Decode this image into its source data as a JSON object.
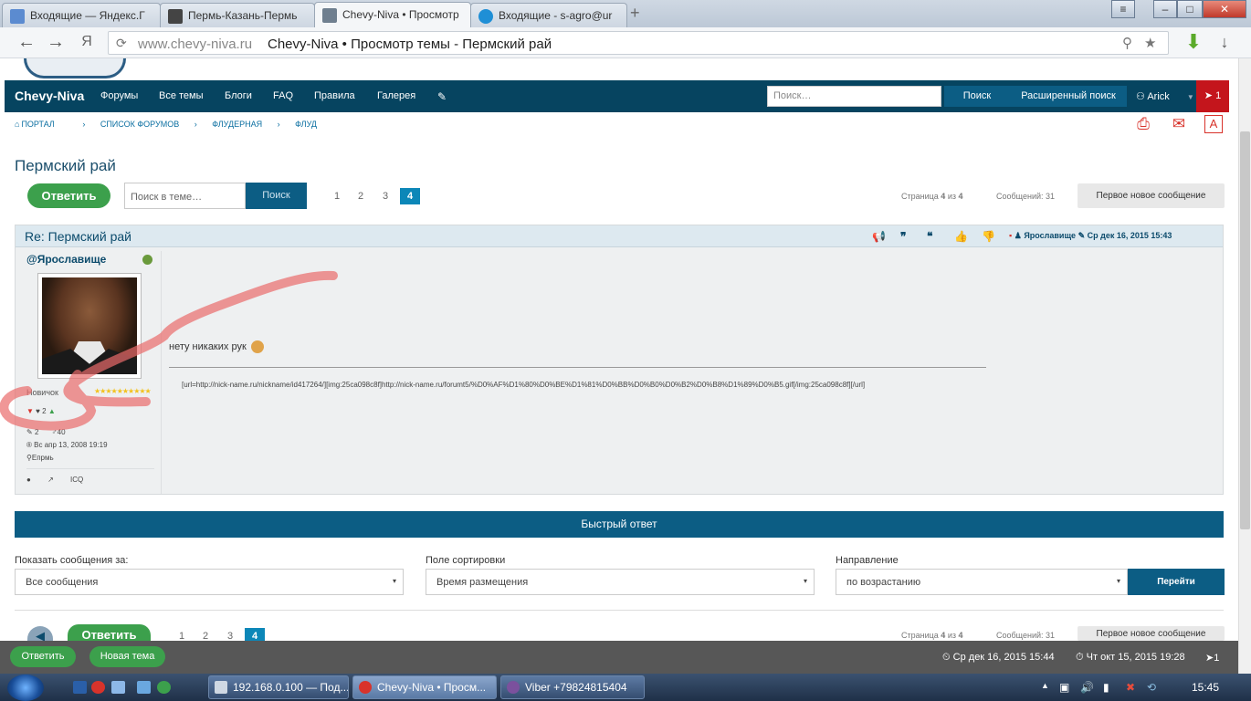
{
  "browser": {
    "tabs": [
      {
        "label": "Входящие — Яндекс.Г",
        "color": "#5b8bd0"
      },
      {
        "label": "Пермь-Казань-Пермь",
        "color": "#444444"
      },
      {
        "label": "Chevy-Niva • Просмотр",
        "color": "#6f7f8f"
      },
      {
        "label": "Входящие - s-agro@ur",
        "color": "#1f8fd6"
      }
    ],
    "url_domain": "www.chevy-niva.ru",
    "url_title": "Chevy-Niva • Просмотр темы - Пермский рай",
    "back_icon": "arrow-left-icon",
    "forward_icon": "arrow-right-icon",
    "yandex_glyph": "Я"
  },
  "navbar": {
    "brand": "Chevy-Niva",
    "links": [
      "Форумы",
      "Все темы",
      "Блоги",
      "FAQ",
      "Правила",
      "Галерея"
    ],
    "search_placeholder": "Поиск…",
    "search_button": "Поиск",
    "advanced_search": "Расширенный поиск",
    "user": "Arick",
    "notifications": "1"
  },
  "breadcrumbs": [
    "Портал",
    "Список форумов",
    "Флудерная",
    "Флуд"
  ],
  "topic": {
    "title": "Пермский рай",
    "reply_button": "Ответить",
    "search_placeholder": "Поиск в теме…",
    "search_button": "Поиск",
    "pages": [
      "1",
      "2",
      "3",
      "4"
    ],
    "current_page": "4",
    "page_info_prefix": "Страница ",
    "page_info_current": "4",
    "page_info_mid": " из ",
    "page_info_total": "4",
    "messages_label": "Сообщений: 31",
    "first_new": "Первое новое сообщение"
  },
  "post": {
    "title": "Re: Пермский рай",
    "author_meta": "Ярославище",
    "date": "Ср дек 16, 2015 15:43",
    "username": "@Ярославище",
    "rank": "Новичок",
    "rep": "2",
    "posts_count": "2",
    "gender_age": "40",
    "registered": "Вс апр 13, 2008 19:19",
    "location": "Епрмь",
    "contact_icq": "ICQ",
    "body": "нету никаких рук",
    "signature": "[url=http://nick-name.ru/nickname/id417264/][img:25ca098c8f]http://nick-name.ru/forumt5/%D0%AF%D1%80%D0%BE%D1%81%D0%BB%D0%B0%D0%B2%D0%B8%D1%89%D0%B5.gif[/img:25ca098c8f][/url]"
  },
  "quick_reply": "Быстрый ответ",
  "sort": {
    "show_label": "Показать сообщения за:",
    "show_value": "Все сообщения",
    "field_label": "Поле сортировки",
    "field_value": "Время размещения",
    "dir_label": "Направление",
    "dir_value": "по возрастанию",
    "go_button": "Перейти"
  },
  "bottom_pager": {
    "reply_button": "Ответить",
    "pages": [
      "1",
      "2",
      "3",
      "4"
    ],
    "page_info_prefix": "Страница ",
    "page_info_current": "4",
    "page_info_mid": " из ",
    "page_info_total": "4",
    "messages_label": "Сообщений: 31",
    "first_new": "Первое новое сообщение"
  },
  "bottombar": {
    "reply": "Ответить",
    "new_topic": "Новая тема",
    "now": "Ср дек 16, 2015 15:44",
    "last_visit": "Чт окт 15, 2015 19:28",
    "notifications": "1"
  },
  "taskbar": {
    "tasks": [
      "192.168.0.100 — Под...",
      "Chevy-Niva • Просм...",
      "Viber +79824815404"
    ],
    "clock": "15:45"
  }
}
